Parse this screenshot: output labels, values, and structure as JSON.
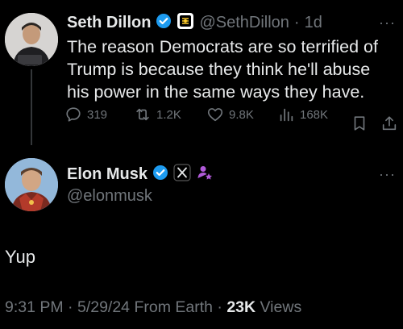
{
  "quoted_tweet": {
    "author_name": "Seth Dillon",
    "handle": "@SethDillon",
    "separator": "·",
    "time": "1d",
    "more": "···",
    "text_lines": [
      "The reason Democrats are so terrified of",
      "Trump is because they think he'll abuse",
      "his power in the same ways they have."
    ],
    "stats": {
      "replies": "319",
      "reposts": "1.2K",
      "likes": "9.8K",
      "views": "168K"
    }
  },
  "main_tweet": {
    "author_name": "Elon Musk",
    "handle": "@elonmusk",
    "more": "···",
    "text": "Yup",
    "meta": {
      "time": "9:31 PM",
      "separator": "·",
      "date": "5/29/24",
      "source": "From Earth",
      "views_count": "23K",
      "views_label": "Views"
    }
  },
  "colors": {
    "background": "#000000",
    "text": "#e7e9ea",
    "muted": "#71767b",
    "verified": "#1d9bf0",
    "affiliate_purple": "#b05ad8"
  }
}
